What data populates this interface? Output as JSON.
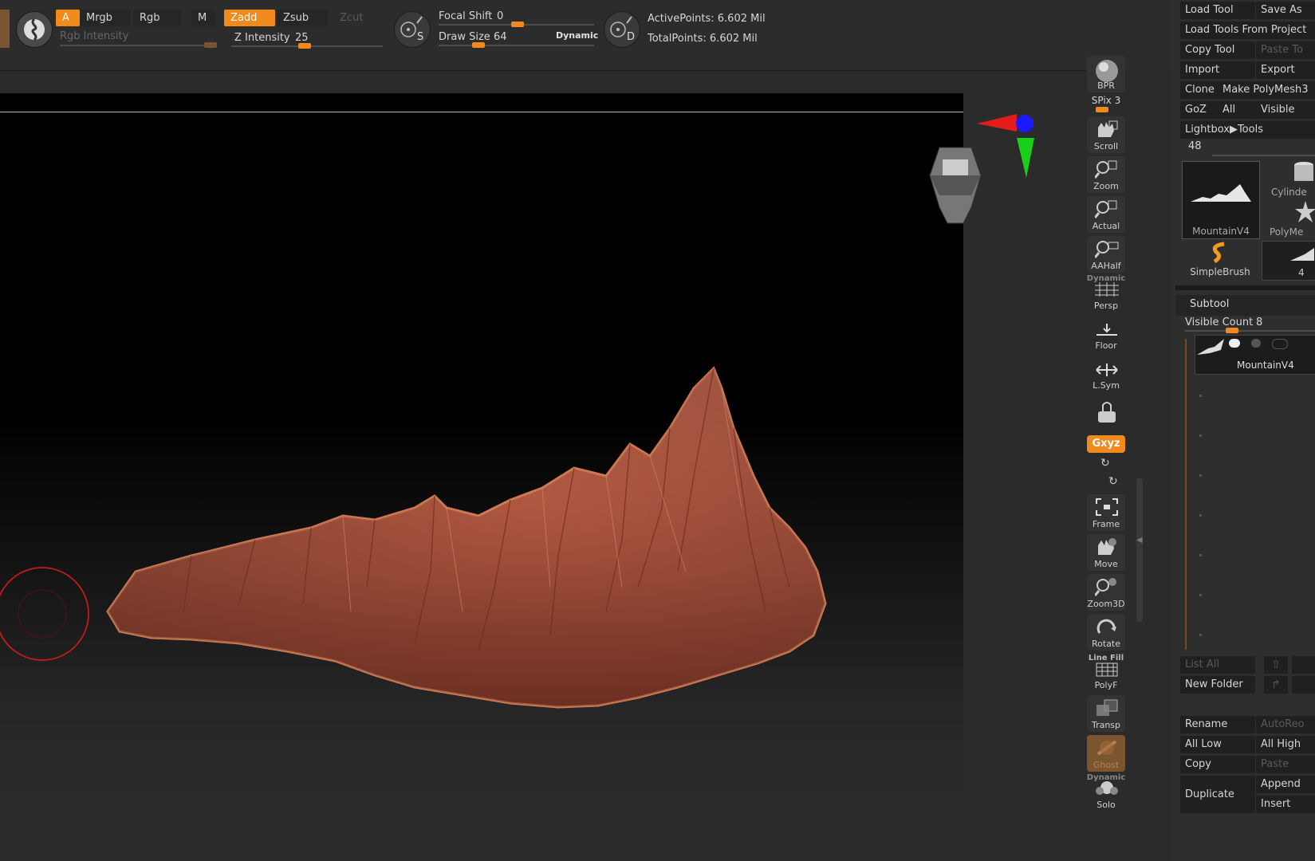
{
  "toolbar": {
    "a_label": "A",
    "mrgb_label": "Mrgb",
    "rgb_label": "Rgb",
    "m_label": "M",
    "zadd_label": "Zadd",
    "zsub_label": "Zsub",
    "zcut_label": "Zcut",
    "rgb_intensity_label": "Rgb Intensity",
    "z_intensity_label": "Z Intensity",
    "z_intensity_value": "25",
    "focal_shift_label": "Focal Shift",
    "focal_shift_value": "0",
    "draw_size_label": "Draw Size",
    "draw_size_value": "64",
    "dynamic_label": "Dynamic",
    "brush_s_label": "S",
    "brush_d_label": "D",
    "active_points": "ActivePoints: 6.602 Mil",
    "total_points": "TotalPoints: 6.602 Mil",
    "accent_color": "#f08a1c"
  },
  "right_toolbar": {
    "bpr": "BPR",
    "spix": "SPix 3",
    "scroll": "Scroll",
    "zoom": "Zoom",
    "actual": "Actual",
    "aahalf": "AAHalf",
    "dynamic": "Dynamic",
    "persp": "Persp",
    "floor": "Floor",
    "lsym": "L.Sym",
    "xyz": "Gxyz",
    "frame": "Frame",
    "move": "Move",
    "zoom3d": "Zoom3D",
    "rotate": "Rotate",
    "line_fill": "Line Fill",
    "polyf": "PolyF",
    "transp": "Transp",
    "ghost": "Ghost",
    "dynamic2": "Dynamic",
    "solo": "Solo"
  },
  "tool_panel": {
    "load_tool": "Load Tool",
    "save_as": "Save As",
    "load_from_project": "Load Tools From Project",
    "copy_tool": "Copy Tool",
    "paste_tool": "Paste To",
    "import": "Import",
    "export": "Export",
    "clone": "Clone",
    "make_polymesh": "Make PolyMesh3",
    "goz": "GoZ",
    "all": "All",
    "visible": "Visible",
    "lightbox_tools": "Lightbox▶Tools",
    "count_value": "48",
    "thumb_main": "MountainV4",
    "thumb_cylinder": "Cylinde",
    "thumb_polymesh": "PolyMe",
    "thumb_simplebrush": "SimpleBrush",
    "thumb_four": "4"
  },
  "subtool": {
    "title": "Subtool",
    "visible_count_label": "Visible Count",
    "visible_count_value": "8",
    "item_name": "MountainV4",
    "list_all": "List All",
    "new_folder": "New Folder",
    "rename": "Rename",
    "autoreorder": "AutoReo",
    "all_low": "All Low",
    "all_high": "All High",
    "copy": "Copy",
    "paste": "Paste",
    "duplicate": "Duplicate",
    "append": "Append",
    "insert": "Insert"
  }
}
